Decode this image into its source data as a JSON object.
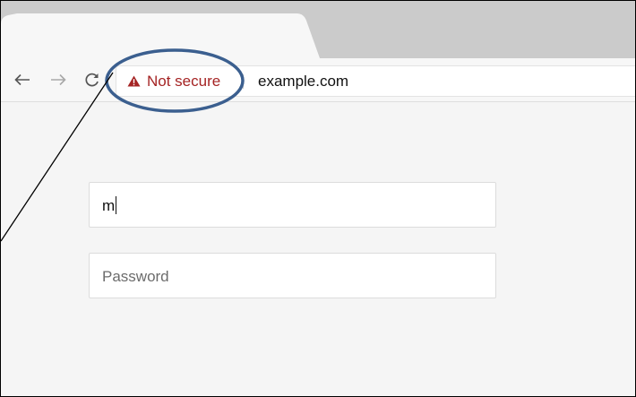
{
  "browser": {
    "nav": {
      "back_icon": "arrow-left-icon",
      "forward_icon": "arrow-right-icon",
      "reload_icon": "reload-icon"
    },
    "omnibox": {
      "security_icon": "warning-triangle-icon",
      "security_label": "Not secure",
      "url": "example.com"
    },
    "colors": {
      "security_text": "#a52424",
      "annotation_ellipse": "#3b5f8f"
    }
  },
  "login_form": {
    "username_value": "m",
    "password_placeholder": "Password"
  }
}
